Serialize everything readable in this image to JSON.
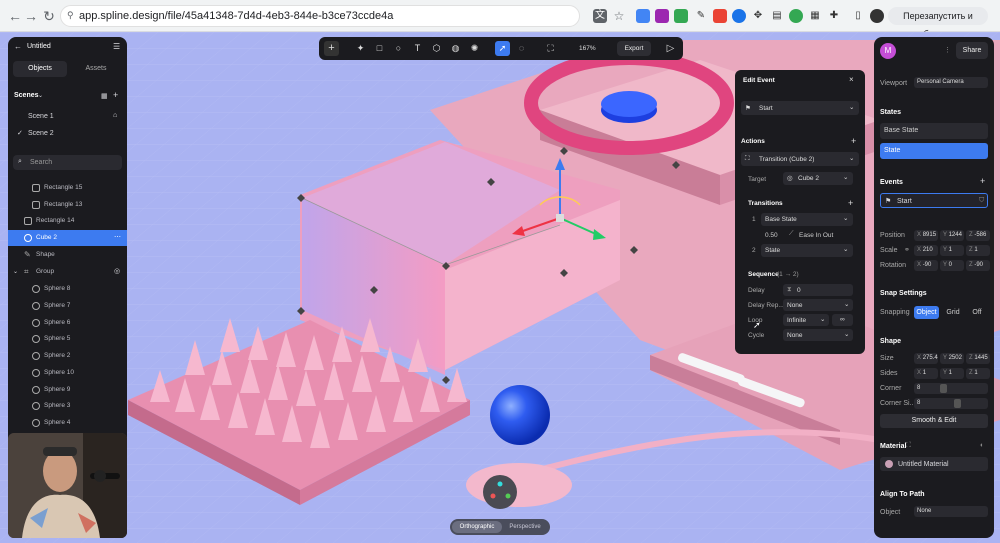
{
  "browser": {
    "url": "app.spline.design/file/45a41348-7d4d-4eb3-844e-b3ce73ccde4a",
    "relaunch_label": "Перезапустить и обновить",
    "avatar_letter": "M"
  },
  "left_panel": {
    "title": "Untitled",
    "tabs": [
      "Objects",
      "Assets"
    ],
    "scenes_label": "Scenes",
    "scenes": [
      "Scene 1",
      "Scene 2"
    ],
    "search_placeholder": "Search",
    "objects": [
      "Rectangle 15",
      "Rectangle 13",
      "Rectangle 14",
      "Cube 2",
      "Shape",
      "Group",
      "Sphere 8",
      "Sphere 7",
      "Sphere 6",
      "Sphere 5",
      "Sphere 2",
      "Sphere 10",
      "Sphere 9",
      "Sphere 3",
      "Sphere 4"
    ]
  },
  "toolbar": {
    "zoom": "167%",
    "export_label": "Export"
  },
  "edit_event": {
    "title": "Edit Event",
    "trigger": "Start",
    "actions_label": "Actions",
    "action": "Transition (Cube 2)",
    "target_label": "Target",
    "target_value": "Cube 2",
    "transitions_label": "Transitions",
    "transition_1": "Base State",
    "transition_duration": "0.50",
    "easing": "Ease In Out",
    "transition_2": "State",
    "sequence_label": "Sequence",
    "sequence_note": "(1 → 2)",
    "delay_label": "Delay",
    "delay_value": "0",
    "delay_repeat_label": "Delay Rep...",
    "delay_repeat_value": "None",
    "loop_label": "Loop",
    "loop_value": "Infinite",
    "cycle_label": "Cycle",
    "cycle_value": "None",
    "step_1": "1",
    "step_2": "2"
  },
  "right_panel": {
    "share_label": "Share",
    "viewport_label": "Viewport",
    "viewport_value": "Personal Camera",
    "states_label": "States",
    "states": [
      "Base State",
      "State"
    ],
    "events_label": "Events",
    "event": "Start",
    "position_label": "Position",
    "position": [
      "8915",
      "1244",
      "-586"
    ],
    "scale_label": "Scale",
    "scale": [
      "210",
      "1",
      "1"
    ],
    "rotation_label": "Rotation",
    "rotation": [
      "-90",
      "0",
      "-90"
    ],
    "snapping_settings_label": "Snap Settings",
    "snapping_label": "Snapping",
    "snapping_options": [
      "Object",
      "Grid",
      "Off"
    ],
    "shape_label": "Shape",
    "size_label": "Size",
    "size": [
      "275.4",
      "2502",
      "1445"
    ],
    "sides_label": "Sides",
    "sides": [
      "1",
      "1",
      "1"
    ],
    "corner_label": "Corner",
    "corner_value": "8",
    "corner_sides_label": "Corner Si...",
    "corner_sides_value": "8",
    "smooth_edit_label": "Smooth & Edit",
    "material_label": "Material",
    "material_value": "Untitled Material",
    "align_label": "Align To Path",
    "object_label": "Object",
    "object_value": "None"
  },
  "view_toggle": [
    "Orthographic",
    "Perspective"
  ],
  "axis_labels": [
    "X",
    "Y",
    "Z"
  ]
}
